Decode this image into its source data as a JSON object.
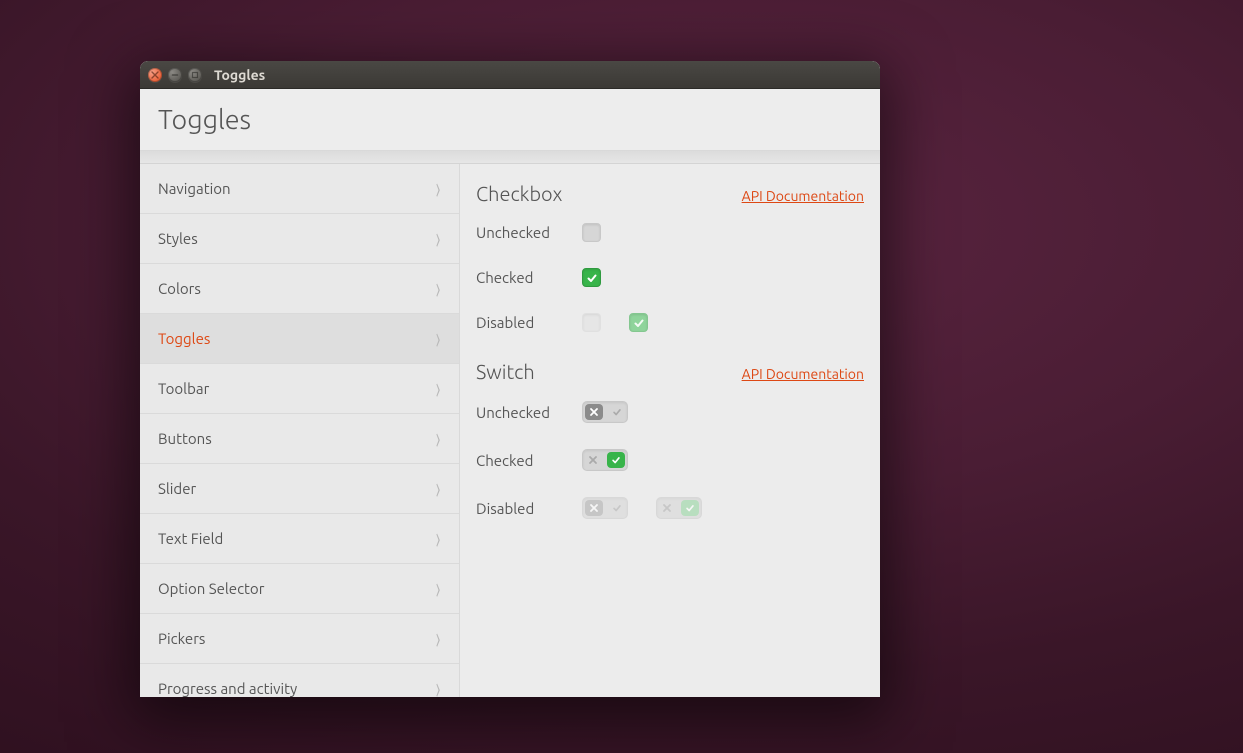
{
  "window": {
    "title": "Toggles"
  },
  "header": {
    "title": "Toggles"
  },
  "sidebar": {
    "items": [
      {
        "label": "Navigation",
        "active": false
      },
      {
        "label": "Styles",
        "active": false
      },
      {
        "label": "Colors",
        "active": false
      },
      {
        "label": "Toggles",
        "active": true
      },
      {
        "label": "Toolbar",
        "active": false
      },
      {
        "label": "Buttons",
        "active": false
      },
      {
        "label": "Slider",
        "active": false
      },
      {
        "label": "Text Field",
        "active": false
      },
      {
        "label": "Option Selector",
        "active": false
      },
      {
        "label": "Pickers",
        "active": false
      },
      {
        "label": "Progress and activity",
        "active": false
      }
    ]
  },
  "sections": {
    "checkbox": {
      "title": "Checkbox",
      "api_link": "API Documentation",
      "rows": {
        "unchecked": "Unchecked",
        "checked": "Checked",
        "disabled": "Disabled"
      }
    },
    "switch": {
      "title": "Switch",
      "api_link": "API Documentation",
      "rows": {
        "unchecked": "Unchecked",
        "checked": "Checked",
        "disabled": "Disabled"
      }
    }
  },
  "colors": {
    "accent": "#dd4814",
    "green": "#38b44a"
  }
}
